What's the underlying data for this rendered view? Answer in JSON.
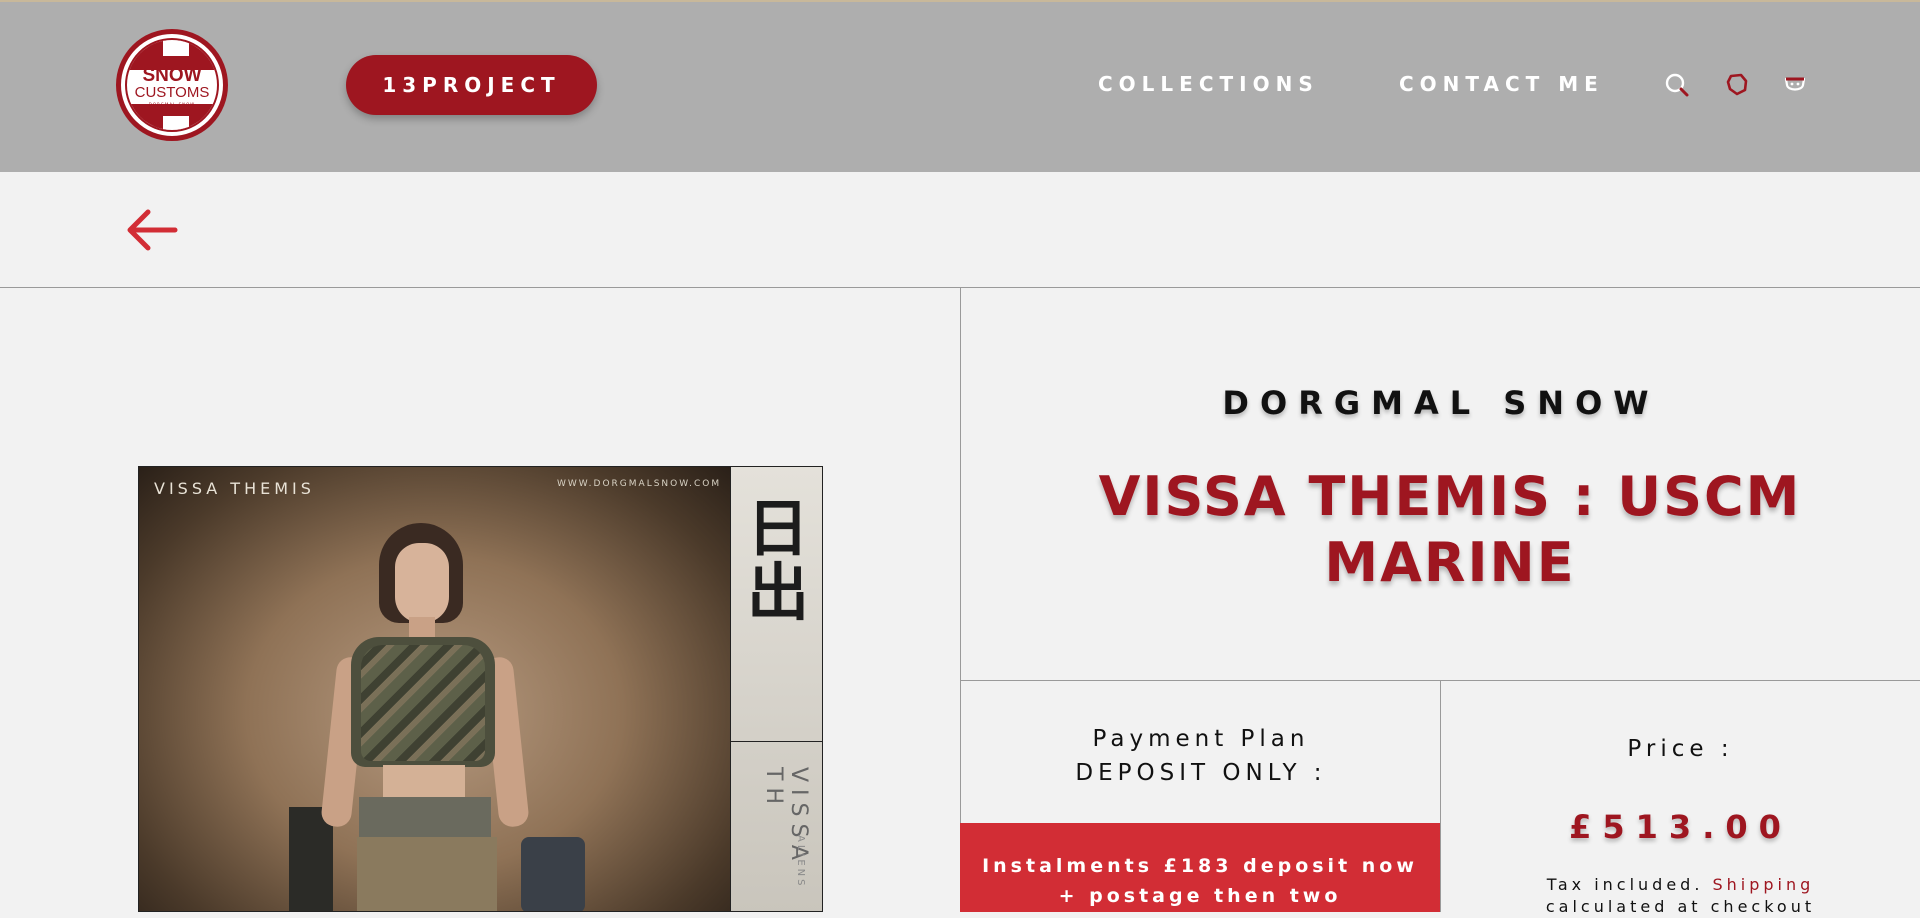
{
  "header": {
    "logo": {
      "line1": "SNOW",
      "line2": "CUSTOMS",
      "line3": "DORGMAL SNOW"
    },
    "project_button": "13PROJECT",
    "nav": [
      "COLLECTIONS",
      "CONTACT ME"
    ],
    "icons": [
      "search-icon",
      "account-icon",
      "cart-icon"
    ]
  },
  "back_icon": "arrow-left-icon",
  "product_image": {
    "title": "VISSA THEMIS",
    "url": "WWW.DORGMALSNOW.COM",
    "kanji": "日出",
    "side_text": "VISSA TH",
    "side_small": "ALIENS"
  },
  "product": {
    "vendor": "DORGMAL SNOW",
    "title": "VISSA THEMIS : USCM MARINE",
    "payment_plan_line1": "Payment Plan",
    "payment_plan_line2": "DEPOSIT ONLY :",
    "instalments_text": "Instalments £183 deposit now + postage then two",
    "price_label": "Price :",
    "price": "£513.00",
    "tax_text": "Tax included.",
    "shipping_link": "Shipping",
    "tax_text_2": "calculated at checkout"
  },
  "colors": {
    "brand_red": "#9e1620",
    "banner_red": "#d22d35",
    "header_gray": "#aeaeae",
    "page_bg": "#f2f2f2"
  }
}
